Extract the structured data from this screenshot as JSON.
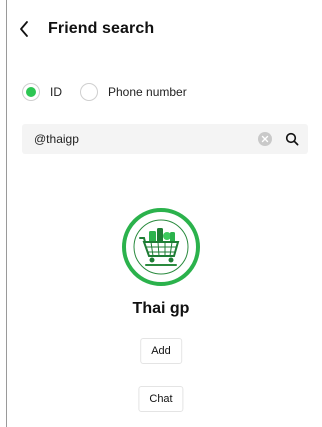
{
  "header": {
    "back_icon": "chevron-left-icon",
    "title": "Friend search"
  },
  "search_type": {
    "options": [
      {
        "label": "ID",
        "selected": true
      },
      {
        "label": "Phone number",
        "selected": false
      }
    ],
    "accent_color": "#2dc653"
  },
  "search": {
    "value": "@thaigp",
    "clear_icon": "clear-circle-icon",
    "search_icon": "search-icon"
  },
  "result": {
    "avatar_icon": "shopping-cart-logo",
    "avatar_ring_color": "#2bb24c",
    "name": "Thai gp",
    "add_label": "Add",
    "chat_label": "Chat"
  }
}
